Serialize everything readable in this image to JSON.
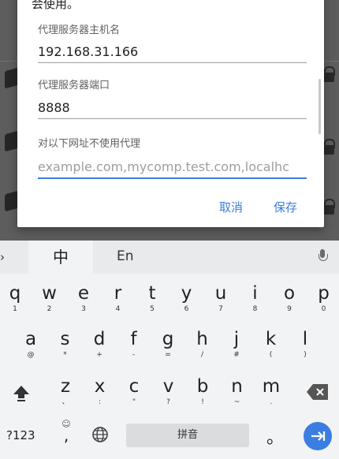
{
  "dialog": {
    "intro": "会使用。",
    "fields": [
      {
        "label": "代理服务器主机名",
        "value": "192.168.31.166"
      },
      {
        "label": "代理服务器端口",
        "value": "8888"
      },
      {
        "label": "对以下网址不使用代理",
        "placeholder": "example.com,mycomp.test.com,localhc"
      }
    ],
    "cancel_label": "取消",
    "save_label": "保存"
  },
  "keyboard": {
    "chevron": "›",
    "lang_zh": "中",
    "lang_en": "En",
    "row1": [
      {
        "k": "q",
        "s": "1"
      },
      {
        "k": "w",
        "s": "2"
      },
      {
        "k": "e",
        "s": "3"
      },
      {
        "k": "r",
        "s": "4"
      },
      {
        "k": "t",
        "s": "5"
      },
      {
        "k": "y",
        "s": "6"
      },
      {
        "k": "u",
        "s": "7"
      },
      {
        "k": "i",
        "s": "8"
      },
      {
        "k": "o",
        "s": "9"
      },
      {
        "k": "p",
        "s": "0"
      }
    ],
    "row2": [
      {
        "k": "a",
        "s": "@"
      },
      {
        "k": "s",
        "s": "*"
      },
      {
        "k": "d",
        "s": "+"
      },
      {
        "k": "f",
        "s": "-"
      },
      {
        "k": "g",
        "s": "="
      },
      {
        "k": "h",
        "s": "/"
      },
      {
        "k": "j",
        "s": "#"
      },
      {
        "k": "k",
        "s": "("
      },
      {
        "k": "l",
        "s": ")"
      }
    ],
    "row3": [
      {
        "k": "z",
        "s": "、"
      },
      {
        "k": "x",
        "s": ":"
      },
      {
        "k": "c",
        "s": "\""
      },
      {
        "k": "v",
        "s": "?"
      },
      {
        "k": "b",
        "s": "!"
      },
      {
        "k": "n",
        "s": "~"
      },
      {
        "k": "m",
        "s": "."
      }
    ],
    "symbols_label": "?123",
    "emoji_label": "☺",
    "comma": ",",
    "space_label": "拼音",
    "period": "。",
    "icons": [
      "chevron-right-icon",
      "microphone-icon",
      "shift-icon",
      "backspace-icon",
      "globe-icon",
      "enter-arrow-icon"
    ],
    "accent_color": "#3b7de0"
  }
}
